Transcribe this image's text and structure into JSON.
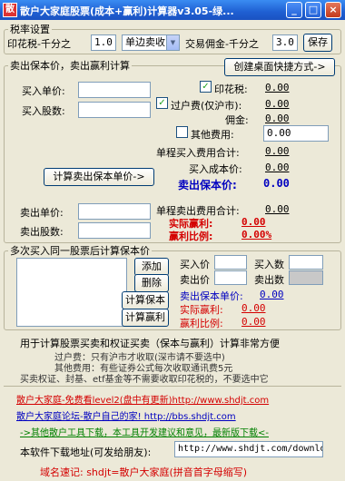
{
  "window": {
    "title": "散户大家庭股票(成本+赢利)计算器v3.05-绿...",
    "app_icon": "散",
    "minimize": "_",
    "maximize": "□",
    "close": "×"
  },
  "tax": {
    "legend": "税率设置",
    "stamp_label": "印花税-千分之",
    "stamp_value": "1.0",
    "side_select": "单边卖收",
    "commission_label": "交易佣金-千分之",
    "commission_value": "3.0",
    "save_button": "保存"
  },
  "calc": {
    "legend": "卖出保本价，卖出赢利计算",
    "shortcut_button": "创建桌面快捷方式->",
    "buy_price_label": "买入单价:",
    "buy_qty_label": "买入股数:",
    "stamp_tax_label": "印花税:",
    "stamp_tax_value": "0.00",
    "transfer_label": "过户费(仅沪市):",
    "transfer_value": "0.00",
    "commission_label": "佣金:",
    "commission_value": "0.00",
    "other_fee_label": "其他费用:",
    "other_fee_value": "0.00",
    "single_buy_total_label": "单程买入费用合计:",
    "single_buy_total_value": "0.00",
    "buy_cost_label": "买入成本价:",
    "buy_cost_value": "0.00",
    "breakeven_label": "卖出保本价:",
    "breakeven_value": "0.00",
    "calc_breakeven_button": "计算卖出保本单价->",
    "sell_price_label": "卖出单价:",
    "sell_qty_label": "卖出股数:",
    "single_sell_total_label": "单程卖出费用合计:",
    "single_sell_total_value": "0.00",
    "actual_profit_label": "实际赢利:",
    "actual_profit_value": "0.00",
    "profit_ratio_label": "赢利比例:",
    "profit_ratio_value": "0.00%"
  },
  "multi": {
    "legend": "多次买入同一股票后计算保本价",
    "add_button": "添加",
    "delete_button": "删除",
    "calc_breakeven_button": "计算保本",
    "calc_profit_button": "计算赢利",
    "buy_price_label": "买入价",
    "buy_qty_label": "买入数",
    "sell_price_label": "卖出价",
    "sell_qty_label": "卖出数",
    "breakeven_label": "卖出保本单价:",
    "breakeven_value": "0.00",
    "actual_profit_label": "实际赢利:",
    "actual_profit_value": "0.00",
    "profit_ratio_label": "赢利比例:",
    "profit_ratio_value": "0.00"
  },
  "notes": {
    "heading": "用于计算股票买卖和权证买卖（保本与赢利）计算非常方便",
    "line1": "过户费：只有沪市才收取(深市请不要选中)",
    "line2": "其他费用：有些证券公式每次收取通讯费5元",
    "line3": "买卖权证、封基、etf基金等不需要收取印花税的，不要选中它"
  },
  "links": {
    "link1": "散户大家庭-免费看level2(盘中有更新)http://www.shdjt.com",
    "link2": "散户大家庭论坛-散户自己的家! http://bbs.shdjt.com",
    "link3": "->其他散户工具下载，本工具开发建议和意见，最新版下载<-",
    "download_label": "本软件下载地址(可发给朋友):",
    "download_url": "http://www.shdjt.com/downlo",
    "domain_note": "域名速记: shdjt=散户大家庭(拼音首字母缩写)"
  }
}
